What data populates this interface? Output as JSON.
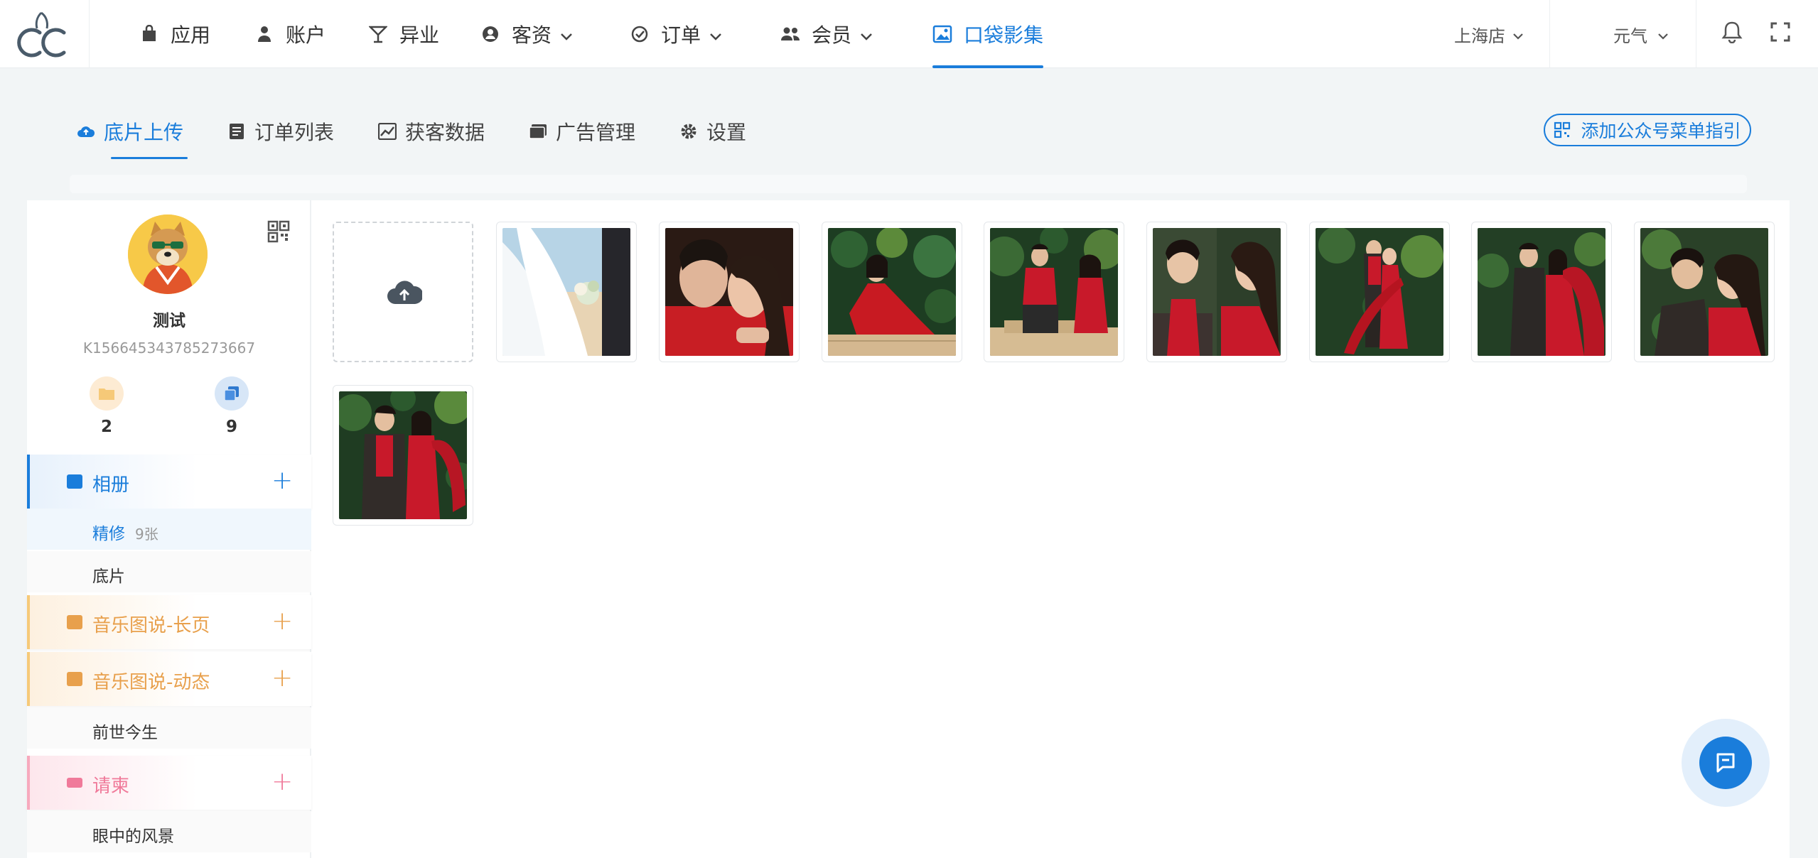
{
  "nav": {
    "items": [
      {
        "label": "应用",
        "icon": "shopping-bag-icon"
      },
      {
        "label": "账户",
        "icon": "user-icon"
      },
      {
        "label": "异业",
        "icon": "cocktail-icon"
      },
      {
        "label": "客资",
        "icon": "contacts-icon"
      },
      {
        "label": "订单",
        "icon": "check-circle-icon"
      },
      {
        "label": "会员",
        "icon": "users-icon"
      },
      {
        "label": "口袋影集",
        "icon": "image-album-icon"
      }
    ],
    "active": "口袋影集",
    "store": "上海店",
    "user": "元气"
  },
  "subtabs": {
    "items": [
      {
        "label": "底片上传",
        "icon": "cloud-upload-icon"
      },
      {
        "label": "订单列表",
        "icon": "list-icon"
      },
      {
        "label": "获客数据",
        "icon": "chart-icon"
      },
      {
        "label": "广告管理",
        "icon": "ad-icon"
      },
      {
        "label": "设置",
        "icon": "gear-icon"
      }
    ],
    "active": "底片上传",
    "guide_label": "添加公众号菜单指引"
  },
  "profile": {
    "name": "测试",
    "id": "K156645343785273667",
    "stats": [
      {
        "value": "2",
        "color": "#f6c978"
      },
      {
        "value": "9",
        "color": "#4a8fe0"
      }
    ]
  },
  "groups": {
    "album": {
      "label": "相册",
      "color": "#1a7ddb"
    },
    "album_subs": [
      {
        "label": "精修",
        "count": "9张",
        "active": true
      },
      {
        "label": "底片",
        "count": ""
      }
    ],
    "music_long": {
      "label": "音乐图说-长页",
      "color": "#e8a04c"
    },
    "music_dyn": {
      "label": "音乐图说-动态",
      "color": "#e8a04c"
    },
    "music_subs": [
      {
        "label": "前世今生"
      }
    ],
    "invite": {
      "label": "请柬",
      "color": "#f07a9a"
    },
    "invite_subs": [
      {
        "label": "眼中的风景"
      }
    ]
  },
  "gallery": {
    "upload_icon": "cloud-upload-icon",
    "photos": [
      {
        "scene": "white-wedding-dress-bouquet"
      },
      {
        "scene": "couple-kiss-red"
      },
      {
        "scene": "woman-red-dress-lying"
      },
      {
        "scene": "couple-sitting-jungle"
      },
      {
        "scene": "couple-split-portrait"
      },
      {
        "scene": "couple-standing-red-fan"
      },
      {
        "scene": "couple-embrace-leaves"
      },
      {
        "scene": "couple-close-face"
      },
      {
        "scene": "couple-standing-front"
      }
    ]
  },
  "chat_button": {
    "icon": "chat-icon"
  }
}
